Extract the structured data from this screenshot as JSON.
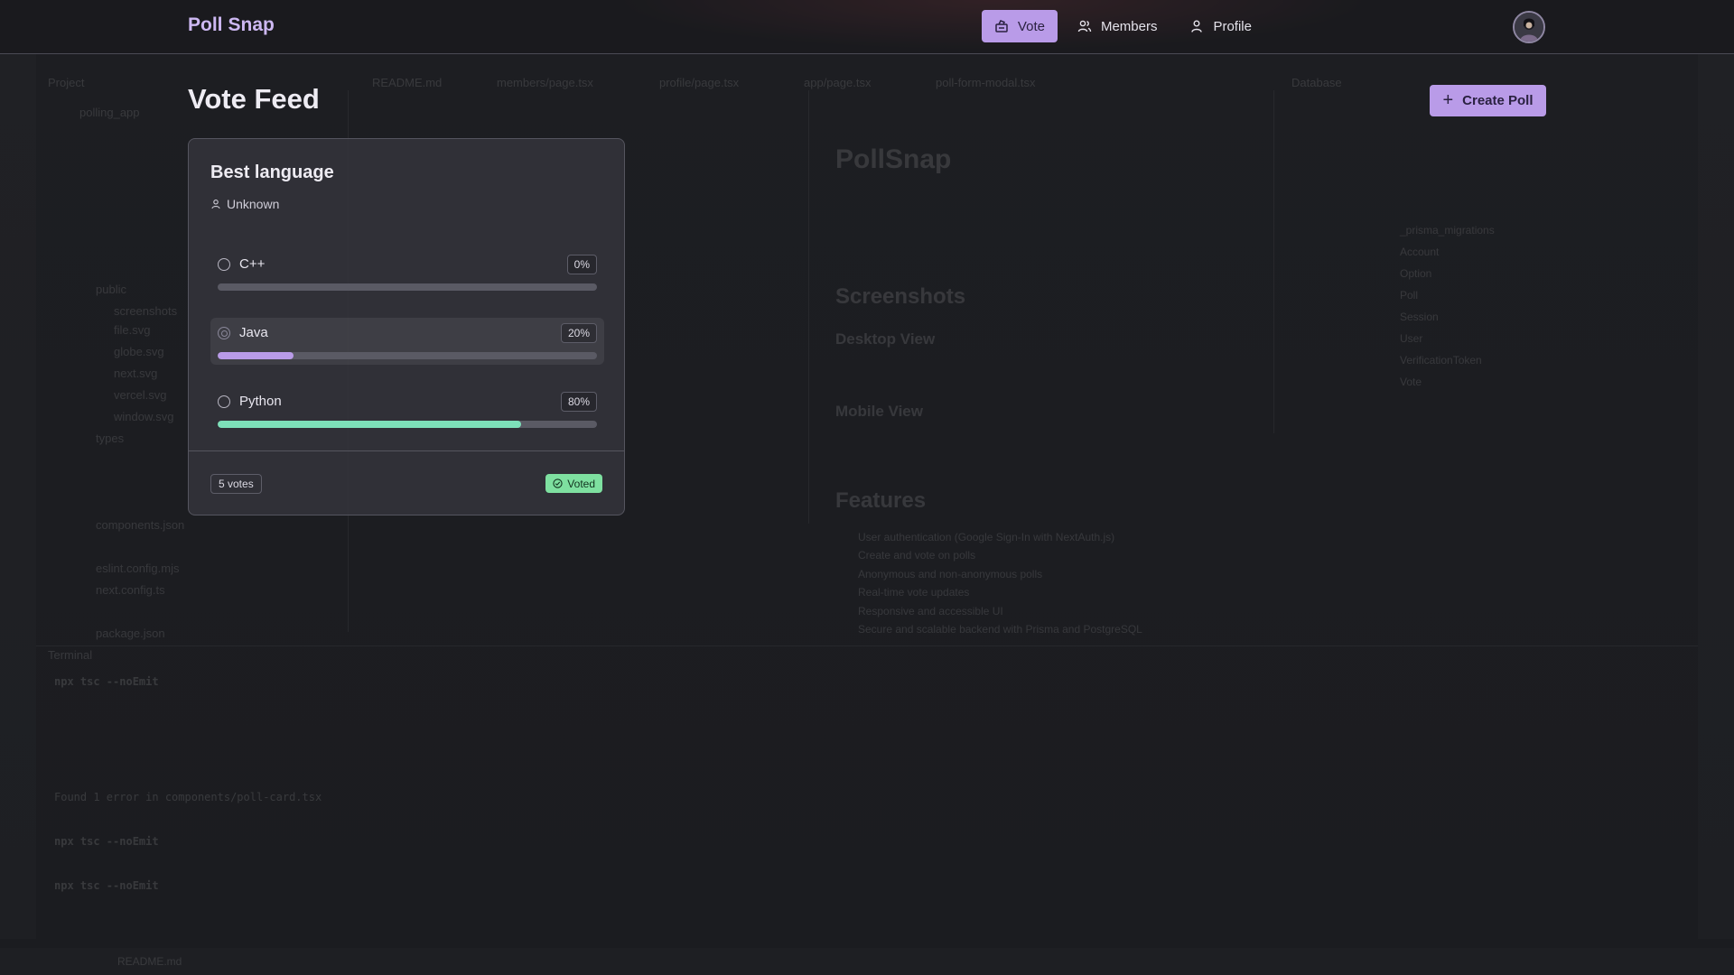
{
  "app": {
    "brand_word1": "Poll",
    "brand_word2": "Snap"
  },
  "nav": {
    "items": [
      {
        "label": "Vote",
        "icon": "ballot-box-icon",
        "active": true
      },
      {
        "label": "Members",
        "icon": "users-icon",
        "active": false
      },
      {
        "label": "Profile",
        "icon": "user-icon",
        "active": false
      }
    ],
    "avatar_icon": "avatar-icon"
  },
  "page": {
    "title": "Vote Feed",
    "create_button_label": "Create Poll",
    "create_button_icon": "plus-icon"
  },
  "poll": {
    "title": "Best language",
    "author": "Unknown",
    "author_icon": "user-icon",
    "options": [
      {
        "label": "C++",
        "percent_label": "0%",
        "percent": 0,
        "selected": false
      },
      {
        "label": "Java",
        "percent_label": "20%",
        "percent": 20,
        "selected": true,
        "bar_color": "#b99be8"
      },
      {
        "label": "Python",
        "percent_label": "80%",
        "percent": 80,
        "selected": false,
        "bar_color": "#7de0b9"
      }
    ],
    "votes_label": "5 votes",
    "voted_label": "Voted",
    "voted_icon": "check-circle-icon"
  },
  "colors": {
    "accent": "#b99be8",
    "voted_badge": "#7ee0a0",
    "python_bar": "#7de0b9"
  },
  "background_ide": {
    "project_label": "Project",
    "root_folder": "polling_app",
    "files": [
      "public",
      "screenshots",
      "file.svg",
      "globe.svg",
      "next.svg",
      "vercel.svg",
      "window.svg",
      "types",
      "components.json",
      "eslint.config.mjs",
      "next.config.ts",
      "package.json"
    ],
    "tabs": [
      "README.md",
      "members/page.tsx",
      "profile/page.tsx",
      "app/page.tsx",
      "poll-form-modal.tsx"
    ],
    "preview_title": "PollSnap",
    "preview_sections": [
      "Screenshots",
      "Desktop View",
      "Mobile View",
      "Features"
    ],
    "features": [
      "User authentication (Google Sign-In with NextAuth.js)",
      "Create and vote on polls",
      "Anonymous and non-anonymous polls",
      "Real-time vote updates",
      "Responsive and accessible UI",
      "Secure and scalable backend with Prisma and PostgreSQL"
    ],
    "database_label": "Database",
    "db_tables": [
      "_prisma_migrations",
      "Account",
      "Option",
      "Poll",
      "Session",
      "User",
      "VerificationToken",
      "Vote"
    ],
    "terminal_label": "Terminal",
    "terminal_lines": [
      "npx tsc --noEmit",
      "Found 1 error in components/poll-card.tsx",
      "npx tsc --noEmit",
      "npx tsc --noEmit"
    ],
    "status_file": "README.md"
  }
}
